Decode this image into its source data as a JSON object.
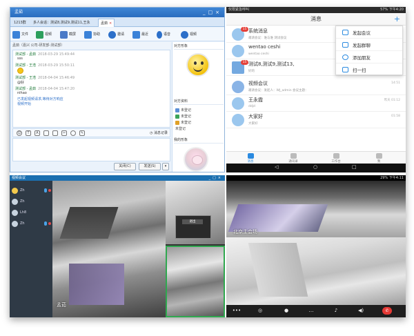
{
  "chat": {
    "title": "孟茹",
    "tabs": [
      {
        "label": "1213群"
      },
      {
        "label": "多人会话：测试8,测试9,测试11,王永"
      },
      {
        "label": "孟茹"
      }
    ],
    "toolbar": [
      {
        "label": "文件"
      },
      {
        "label": "视频"
      },
      {
        "label": "截屏"
      },
      {
        "label": "协助"
      },
      {
        "label": "邀请"
      },
      {
        "label": "最近"
      },
      {
        "label": "语音"
      },
      {
        "label": "视频"
      }
    ],
    "subheader": "孟茹（嘉兴 公司-研发部-测试部）",
    "messages": [
      {
        "sender": "测试部 - 孟茹",
        "time": "2018-03-29 15:49:44",
        "body": "sss"
      },
      {
        "sender": "测试部 - 王浩",
        "time": "2018-03-29 15:50:11",
        "body": ""
      },
      {
        "sender": "测试部 - 王浩",
        "time": "2018-04-04 15:46:49",
        "body": "@好"
      },
      {
        "sender": "测试部 - 孟茹",
        "time": "2018-04-04 15:47:20",
        "body": "nihao"
      }
    ],
    "system_note": "已发起视频请求,等待对方响应",
    "video_link": "视频开始",
    "history_label": "消息记录",
    "close_label": "关闭(C)",
    "send_label": "发送(S)",
    "right_panel": {
      "image_header": "对方形象",
      "info_header": "对方资料",
      "info_items": [
        {
          "label": "未登记",
          "color": "#5b8fd6"
        },
        {
          "label": "未登记",
          "color": "#3aa35a"
        },
        {
          "label": "未登记",
          "color": "#e0a128"
        }
      ],
      "info_extra": "未登记",
      "my_image_header": "我的形象"
    }
  },
  "phone1": {
    "status_left": "仅限紧急呼叫",
    "status_right": "57% 下午4:20",
    "title": "消息",
    "conversations": [
      {
        "name": "系统消息",
        "sub": "邀请会议：谁与谁 测试会议",
        "badge": "15",
        "time": ""
      },
      {
        "name": "wentao ceshi",
        "sub": "wentao ceshi",
        "badge": "",
        "time": ""
      },
      {
        "name": "测试8,测试9,测试13,",
        "sub": "好的",
        "badge": "15",
        "time": ""
      },
      {
        "name": "视频会议",
        "sub": "邀请会议：发起人：WJ_admin 会议主题：",
        "badge": "",
        "time": "14:51"
      },
      {
        "name": "王永霞",
        "sub": "ddjd",
        "badge": "",
        "time": "昨天 01:12"
      },
      {
        "name": "大家好",
        "sub": "大家好",
        "badge": "",
        "time": "01:58"
      }
    ],
    "menu": [
      {
        "label": "发起会议"
      },
      {
        "label": "发起群聊"
      },
      {
        "label": "添加朋友"
      },
      {
        "label": "扫一扫"
      }
    ],
    "bottom_tabs": [
      {
        "label": "消息"
      },
      {
        "label": "通讯录"
      },
      {
        "label": "工作台"
      },
      {
        "label": "我"
      }
    ],
    "nav": [
      "◁",
      "○",
      "□"
    ]
  },
  "video_desktop": {
    "title": "视频会议",
    "participants": [
      {
        "name": "Zh"
      },
      {
        "name": "Zh"
      },
      {
        "name": "Lh8"
      },
      {
        "name": "Zh"
      }
    ],
    "main_label": "孟茹",
    "tag_label": "退出"
  },
  "phone2": {
    "status_left": "",
    "status_right": "29% 下午4:11",
    "video_label": "北京主会场",
    "controls": [
      "•••",
      "◎",
      "●",
      "…",
      "♪",
      "◀)",
      "✆"
    ]
  }
}
